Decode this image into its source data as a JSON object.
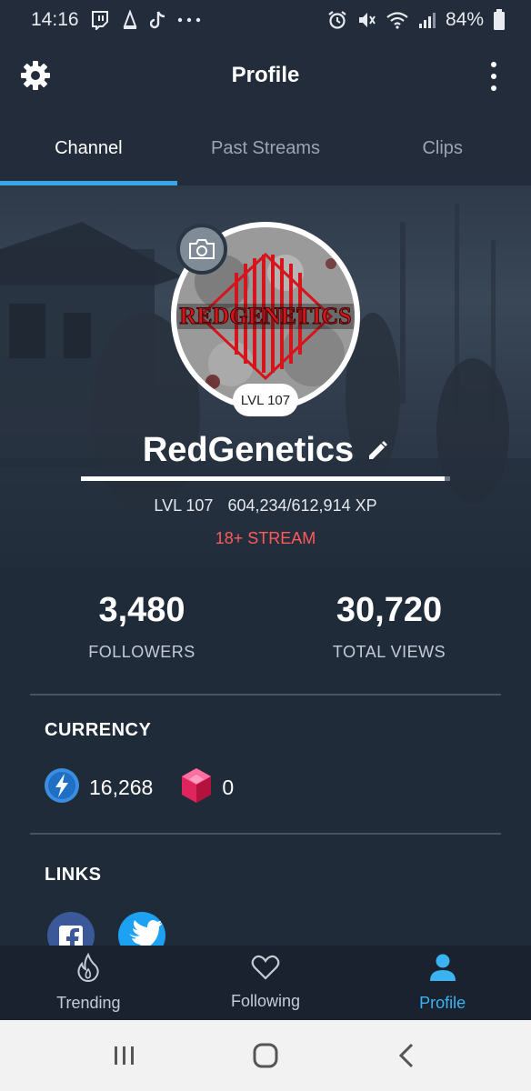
{
  "status_bar": {
    "time": "14:16",
    "battery": "84%",
    "left_icons": [
      "twitch-icon",
      "app-icon",
      "tiktok-icon",
      "more-dots"
    ],
    "right_icons": [
      "alarm-icon",
      "mute-icon",
      "wifi-icon",
      "signal-icon",
      "battery-icon"
    ]
  },
  "header": {
    "title": "Profile"
  },
  "tabs": [
    {
      "label": "Channel",
      "active": true
    },
    {
      "label": "Past Streams",
      "active": false
    },
    {
      "label": "Clips",
      "active": false
    }
  ],
  "profile": {
    "avatar_text": "REDGENETICS",
    "level_badge": "LVL 107",
    "username": "RedGenetics",
    "level": "LVL 107",
    "xp": "604,234/612,914 XP",
    "xp_progress": 0.986,
    "stream_tag": "18+ STREAM"
  },
  "stats": {
    "followers": {
      "value": "3,480",
      "label": "FOLLOWERS"
    },
    "views": {
      "value": "30,720",
      "label": "TOTAL VIEWS"
    }
  },
  "currency": {
    "title": "CURRENCY",
    "sparks": "16,268",
    "gems": "0"
  },
  "links": {
    "title": "LINKS",
    "items": [
      "facebook-icon",
      "twitter-icon"
    ]
  },
  "bottom_nav": [
    {
      "label": "Trending",
      "active": false
    },
    {
      "label": "Following",
      "active": false
    },
    {
      "label": "Profile",
      "active": true
    }
  ],
  "colors": {
    "background": "#202b3a",
    "accent": "#3aa8e8",
    "stream_tag": "#ff5a5a",
    "nav_active": "#3ab4f0"
  }
}
